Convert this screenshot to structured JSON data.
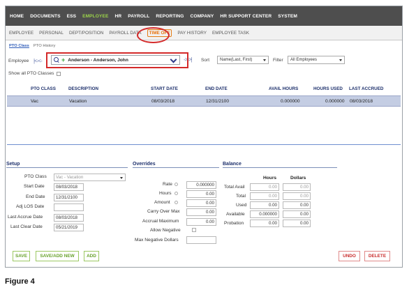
{
  "top_nav": [
    "HOME",
    "DOCUMENTS",
    "ESS",
    "EMPLOYEE",
    "HR",
    "PAYROLL",
    "REPORTING",
    "COMPANY",
    "HR SUPPORT CENTER",
    "SYSTEM"
  ],
  "sub_nav": [
    "EMPLOYEE",
    "PERSONAL",
    "DEPT/POSITION",
    "PAYROLL DATA",
    "TIME OFF",
    "PAY HISTORY",
    "EMPLOYEE TASK"
  ],
  "tabs": [
    "PTO Class",
    "PTO History"
  ],
  "employee": {
    "label": "Employee",
    "nav_left": "|<-<-",
    "nav_right": "->->|",
    "selected": "Anderson - Anderson, John"
  },
  "sort": {
    "label": "Sort",
    "value": "Name(Last, First)"
  },
  "filter": {
    "label": "Filter",
    "value": "All Employees"
  },
  "show_all_label": "Show all PTO Classes",
  "grid": {
    "columns": [
      "PTO CLASS",
      "DESCRIPTION",
      "START DATE",
      "END DATE",
      "AVAIL HOURS",
      "HOURS USED",
      "LAST ACCRUED"
    ],
    "rows": [
      {
        "pto_class": "Vac",
        "description": "Vacation",
        "start_date": "08/03/2018",
        "end_date": "12/31/2100",
        "avail_hours": "0.000000",
        "hours_used": "0.000000",
        "last_accrued": "08/03/2018"
      }
    ]
  },
  "setup": {
    "title": "Setup",
    "pto_class_label": "PTO Class",
    "pto_class_value": "Vac - Vacation",
    "start_date_label": "Start Date",
    "start_date": "08/03/2018",
    "end_date_label": "End Date",
    "end_date": "12/31/2100",
    "adj_los_label": "Adj LOS Date",
    "adj_los": "",
    "last_accrue_label": "Last Accrue Date",
    "last_accrue": "08/03/2018",
    "last_clear_label": "Last Clear Date",
    "last_clear": "05/21/2019"
  },
  "overrides": {
    "title": "Overrides",
    "rate_label": "Rate",
    "rate": "0.000000",
    "hours_label": "Hours",
    "hours": "0.00",
    "amount_label": "Amount",
    "amount": "0.00",
    "carry_label": "Carry Over Max",
    "carry": "0.00",
    "accrual_label": "Accrual Maximum",
    "accrual": "0.00",
    "allow_neg_label": "Allow Negative",
    "max_neg_label": "Max Negative Dollars",
    "max_neg": ""
  },
  "balance": {
    "title": "Balance",
    "hours_head": "Hours",
    "dollars_head": "Dollars",
    "rows": [
      {
        "label": "Total Avail",
        "hours": "0.00",
        "dollars": "0.00"
      },
      {
        "label": "Total",
        "hours": "0.00",
        "dollars": "0.00"
      },
      {
        "label": "Used",
        "hours": "0.00",
        "dollars": "0.00"
      },
      {
        "label": "Available",
        "hours": "0.000000",
        "dollars": "0.00"
      },
      {
        "label": "Probation",
        "hours": "0.00",
        "dollars": "0.00"
      }
    ]
  },
  "buttons": {
    "save": "SAVE",
    "save_add_new": "SAVE/ADD NEW",
    "add": "ADD",
    "undo": "UNDO",
    "delete": "DELETE"
  },
  "caption": "Figure 4",
  "colors": {
    "nav_bg": "#4e4e4e",
    "nav_active": "#9bd34a",
    "tab_active": "#e8720c",
    "callout": "#d42a2a",
    "row_selected": "#c4cde3",
    "button_green": "#67a12a",
    "button_red": "#c92e2e"
  }
}
